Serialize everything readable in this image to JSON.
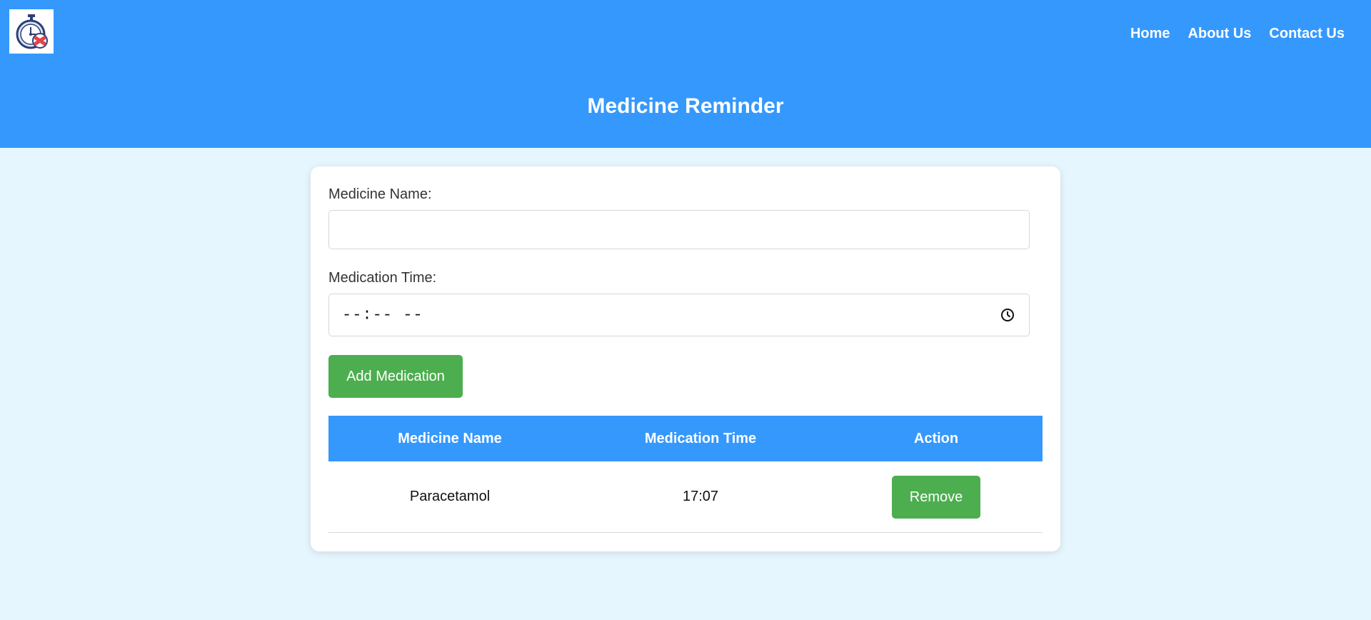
{
  "nav": {
    "items": [
      "Home",
      "About Us",
      "Contact Us"
    ]
  },
  "logo": {
    "icon": "stopwatch-pill-icon"
  },
  "page_title": "Medicine Reminder",
  "form": {
    "medicine_name_label": "Medicine Name:",
    "medicine_name_value": "",
    "medication_time_label": "Medication Time:",
    "medication_time_value": "--:-- --",
    "add_button_label": "Add Medication"
  },
  "table": {
    "columns": [
      "Medicine Name",
      "Medication Time",
      "Action"
    ],
    "rows": [
      {
        "name": "Paracetamol",
        "time": "17:07",
        "action": "Remove"
      }
    ]
  },
  "colors": {
    "header": "#3598fd",
    "background": "#e6f6fe",
    "button": "#4cae4f"
  }
}
